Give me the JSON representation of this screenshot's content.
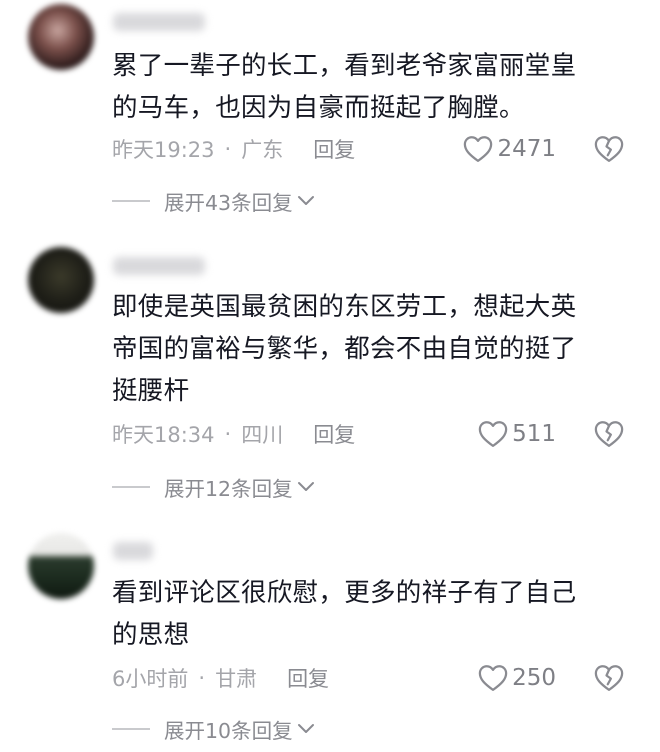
{
  "comments": [
    {
      "text": "累了一辈子的长工，看到老爷家富丽堂皇的马车，也因为自豪而挺起了胸膛。",
      "lines": [
        "累了一辈子的长工，看到老爷家富丽堂皇",
        "的马车，也因为自豪而挺起了胸膛。"
      ],
      "time": "昨天19:23",
      "location": "广东",
      "reply_label": "回复",
      "likes": "2471",
      "expand_label": "展开43条回复"
    },
    {
      "text": "即使是英国最贫困的东区劳工，想起大英帝国的富裕与繁华，都会不由自觉的挺了挺腰杆",
      "lines": [
        "即使是英国最贫困的东区劳工，想起大英",
        "帝国的富裕与繁华，都会不由自觉的挺了",
        "挺腰杆"
      ],
      "time": "昨天18:34",
      "location": "四川",
      "reply_label": "回复",
      "likes": "511",
      "expand_label": "展开12条回复"
    },
    {
      "text": "看到评论区很欣慰，更多的祥子有了自己的思想",
      "lines": [
        "看到评论区很欣慰，更多的祥子有了自己",
        "的思想"
      ],
      "time": "6小时前",
      "location": "甘肃",
      "reply_label": "回复",
      "likes": "250",
      "expand_label": "展开10条回复"
    }
  ],
  "separator": "·",
  "icons": {
    "like": "heart-outline-icon",
    "dislike": "broken-heart-icon",
    "expand": "chevron-down-icon"
  },
  "colors": {
    "text": "#161823",
    "meta": "#a4a5aa",
    "secondary": "#8a8b91"
  }
}
